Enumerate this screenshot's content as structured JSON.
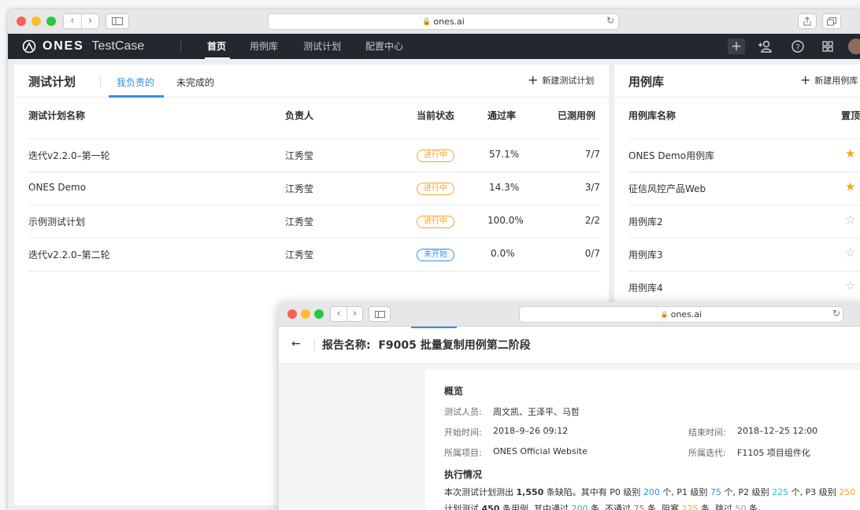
{
  "browser_back": {
    "url": "ones.ai"
  },
  "nav": {
    "brand": "ONES",
    "product": "TestCase",
    "items": [
      "首页",
      "用例库",
      "测试计划",
      "配置中心"
    ],
    "active_index": 0
  },
  "test_plans": {
    "title": "测试计划",
    "tabs": [
      "我负责的",
      "未完成的"
    ],
    "active_tab": 0,
    "new_label": "新建测试计划",
    "columns": [
      "测试计划名称",
      "负责人",
      "当前状态",
      "通过率",
      "已测用例"
    ],
    "rows": [
      {
        "name": "迭代v2.2.0–第一轮",
        "owner": "江秀莹",
        "status": "进行中",
        "rate": "57.1%",
        "tested": "7/7"
      },
      {
        "name": "ONES Demo",
        "owner": "江秀莹",
        "status": "进行中",
        "rate": "14.3%",
        "tested": "3/7"
      },
      {
        "name": "示例测试计划",
        "owner": "江秀莹",
        "status": "进行中",
        "rate": "100.0%",
        "tested": "2/2"
      },
      {
        "name": "迭代v2.2.0–第二轮",
        "owner": "江秀莹",
        "status": "未开始",
        "rate": "0.0%",
        "tested": "0/7"
      }
    ]
  },
  "case_library": {
    "title": "用例库",
    "new_label": "新建用例库",
    "columns": [
      "用例库名称",
      "置顶"
    ],
    "rows": [
      {
        "name": "ONES Demo用例库",
        "pinned": true
      },
      {
        "name": "征信风控产品Web",
        "pinned": true
      },
      {
        "name": "用例库2",
        "pinned": false
      },
      {
        "name": "用例库3",
        "pinned": false
      },
      {
        "name": "用例库4",
        "pinned": false
      }
    ]
  },
  "browser_front": {
    "url": "ones.ai"
  },
  "report": {
    "title": "报告名称:  F9005 批量复制用例第二阶段",
    "overview_title": "概览",
    "testers_label": "测试人员:",
    "testers": "周文凯、王泽平、马哲",
    "start_label": "开始时间:",
    "start": "2018–9–26 09:12",
    "end_label": "结束时间:",
    "end": "2018–12–25 12:00",
    "project_label": "所属项目:",
    "project": "ONES Official Website",
    "iteration_label": "所属迭代:",
    "iteration": "F1105 项目组件化",
    "exec_title": "执行情况",
    "line1": {
      "t1": "本次测试计划测出 ",
      "total": "1,550",
      "t2": " 条缺陷。其中有 P0 级别 ",
      "p0": "200",
      "t3": " 个, P1 级别 ",
      "p1": "75",
      "t4": " 个, P2 级别 ",
      "p2": "225",
      "t5": " 个, P3 级别 ",
      "p3": "250"
    },
    "line2": {
      "t1": "计划测试 ",
      "planned": "450",
      "t2": " 条用例, 其中通过 ",
      "passed": "200",
      "t3": " 条, 不通过 ",
      "failed": "75",
      "t4": " 条, 阻塞 ",
      "blocked": "225",
      "t5": " 条, 跳过 ",
      "skipped": "50",
      "t6": " 条。"
    }
  },
  "colors": {
    "accent": "#338fe5",
    "in_progress": "#f5a623",
    "not_started": "#338fe5",
    "pass": "#36b37e",
    "fail": "#e5533d",
    "star_on": "#f5a623",
    "star_off": "#b8b8b8",
    "navbar": "#23272e"
  }
}
